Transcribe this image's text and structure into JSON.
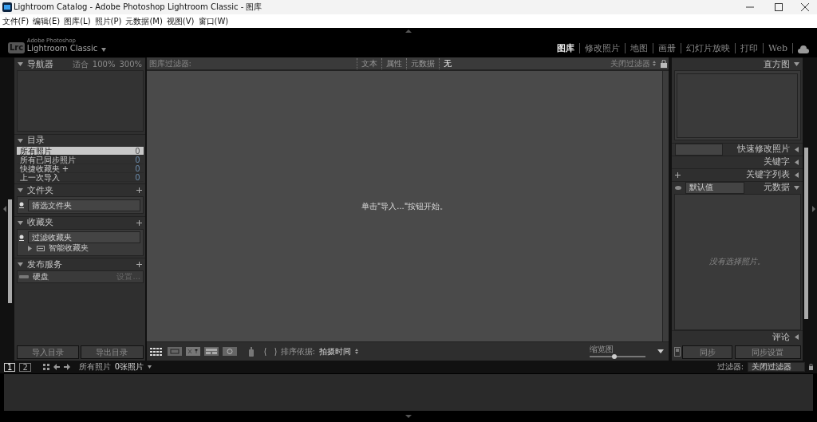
{
  "window": {
    "title": "Lightroom Catalog - Adobe Photoshop Lightroom Classic - 图库"
  },
  "menu": [
    "文件(F)",
    "编辑(E)",
    "图库(L)",
    "照片(P)",
    "元数据(M)",
    "视图(V)",
    "窗口(W)"
  ],
  "identity": {
    "logo": "Lrc",
    "vendor": "Adobe Photoshop",
    "product": "Lightroom Classic",
    "modules": [
      {
        "label": "图库",
        "selected": true
      },
      {
        "label": "修改照片",
        "selected": false
      },
      {
        "label": "地图",
        "selected": false
      },
      {
        "label": "画册",
        "selected": false
      },
      {
        "label": "幻灯片放映",
        "selected": false
      },
      {
        "label": "打印",
        "selected": false
      },
      {
        "label": "Web",
        "selected": false
      }
    ]
  },
  "left_panel": {
    "navigator": {
      "title": "导航器",
      "expanded": true,
      "zoom_options": [
        "适合",
        "100%",
        "300%"
      ]
    },
    "catalog": {
      "title": "目录",
      "expanded": true,
      "items": [
        {
          "label": "所有照片",
          "count": "0",
          "selected": true
        },
        {
          "label": "所有已同步照片",
          "count": "0",
          "selected": false
        },
        {
          "label": "快捷收藏夹 +",
          "count": "0",
          "selected": false
        },
        {
          "label": "上一次导入",
          "count": "0",
          "selected": false
        }
      ]
    },
    "folders": {
      "title": "文件夹",
      "expanded": true,
      "filter_placeholder": "筛选文件夹"
    },
    "collections": {
      "title": "收藏夹",
      "expanded": true,
      "filter_placeholder": "过滤收藏夹",
      "items": [
        {
          "label": "智能收藏夹",
          "expanded": false
        }
      ]
    },
    "publish": {
      "title": "发布服务",
      "expanded": true,
      "services": [
        {
          "label": "硬盘",
          "action": "设置..."
        }
      ]
    },
    "buttons": [
      "导入目录",
      "导出目录"
    ]
  },
  "filter_bar": {
    "title": "图库过滤器:",
    "tabs": [
      {
        "label": "文本",
        "selected": false
      },
      {
        "label": "属性",
        "selected": false
      },
      {
        "label": "元数据",
        "selected": false
      },
      {
        "label": "无",
        "selected": true
      }
    ],
    "preset": "关闭过滤器"
  },
  "grid": {
    "message": "单击\"导入...\"按钮开始。"
  },
  "toolbar": {
    "sort_label": "排序依据:",
    "sort_value": "拍摄时间",
    "thumbnail_label": "缩览图",
    "thumbnail_size": {
      "level": 0.45
    }
  },
  "right_panel": {
    "sections": [
      {
        "kind": "histogram",
        "title": "直方图",
        "expanded": true
      },
      {
        "kind": "quick_develop",
        "title": "快速修改照片",
        "expanded": false
      },
      {
        "kind": "keywording",
        "title": "关键字",
        "expanded": false
      },
      {
        "kind": "keyword_list",
        "title": "关键字列表",
        "expanded": false
      },
      {
        "kind": "metadata",
        "title": "元数据",
        "expanded": true,
        "preset": "默认值",
        "message": "没有选择照片。"
      },
      {
        "kind": "comments",
        "title": "评论",
        "expanded": false
      }
    ],
    "buttons": [
      "同步",
      "同步设置"
    ]
  },
  "filmstrip": {
    "screens": [
      {
        "label": "1",
        "selected": true
      },
      {
        "label": "2",
        "selected": false
      }
    ],
    "source": "所有照片",
    "count": "0张照片",
    "filter_label": "过滤器:",
    "filter_value": "关闭过滤器"
  }
}
